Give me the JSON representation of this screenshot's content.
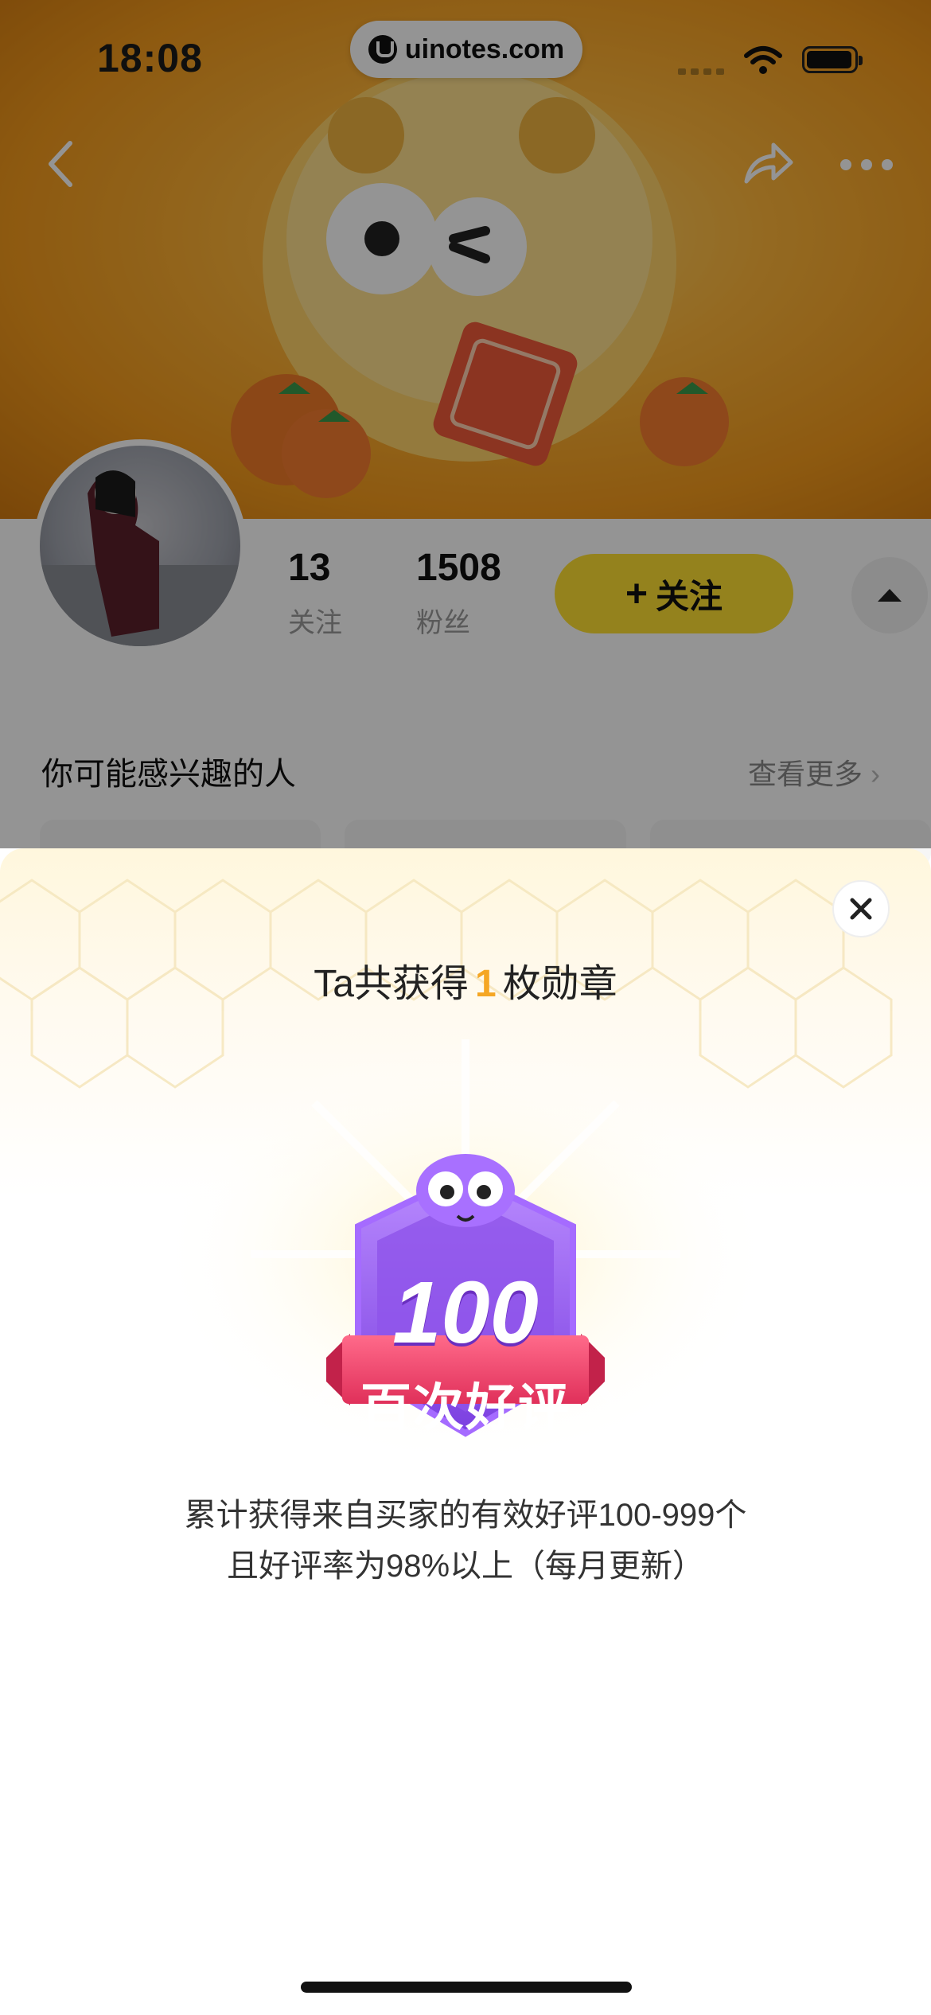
{
  "status_bar": {
    "time": "18:08",
    "url": "uinotes.com"
  },
  "nav": {
    "back_icon": "chevron-left-icon",
    "share_icon": "share-icon",
    "more_icon": "more-dots-icon"
  },
  "profile": {
    "following_count": "13",
    "following_label": "关注",
    "fans_count": "1508",
    "fans_label": "粉丝",
    "follow_button": "关注",
    "follow_plus": "+"
  },
  "recommend": {
    "title": "你可能感兴趣的人",
    "more": "查看更多"
  },
  "sheet": {
    "title_prefix": "Ta共获得",
    "medal_count": "1",
    "title_suffix": "枚勋章",
    "badge_number": "100",
    "badge_name": "百次好评",
    "desc_line1": "累计获得来自买家的有效好评100-999个",
    "desc_line2": "且好评率为98%以上（每月更新）"
  },
  "colors": {
    "accent_yellow": "#ffe033",
    "count_orange": "#f5a623",
    "badge_purple": "#9a5cf0",
    "ribbon_pink": "#e8426e"
  }
}
